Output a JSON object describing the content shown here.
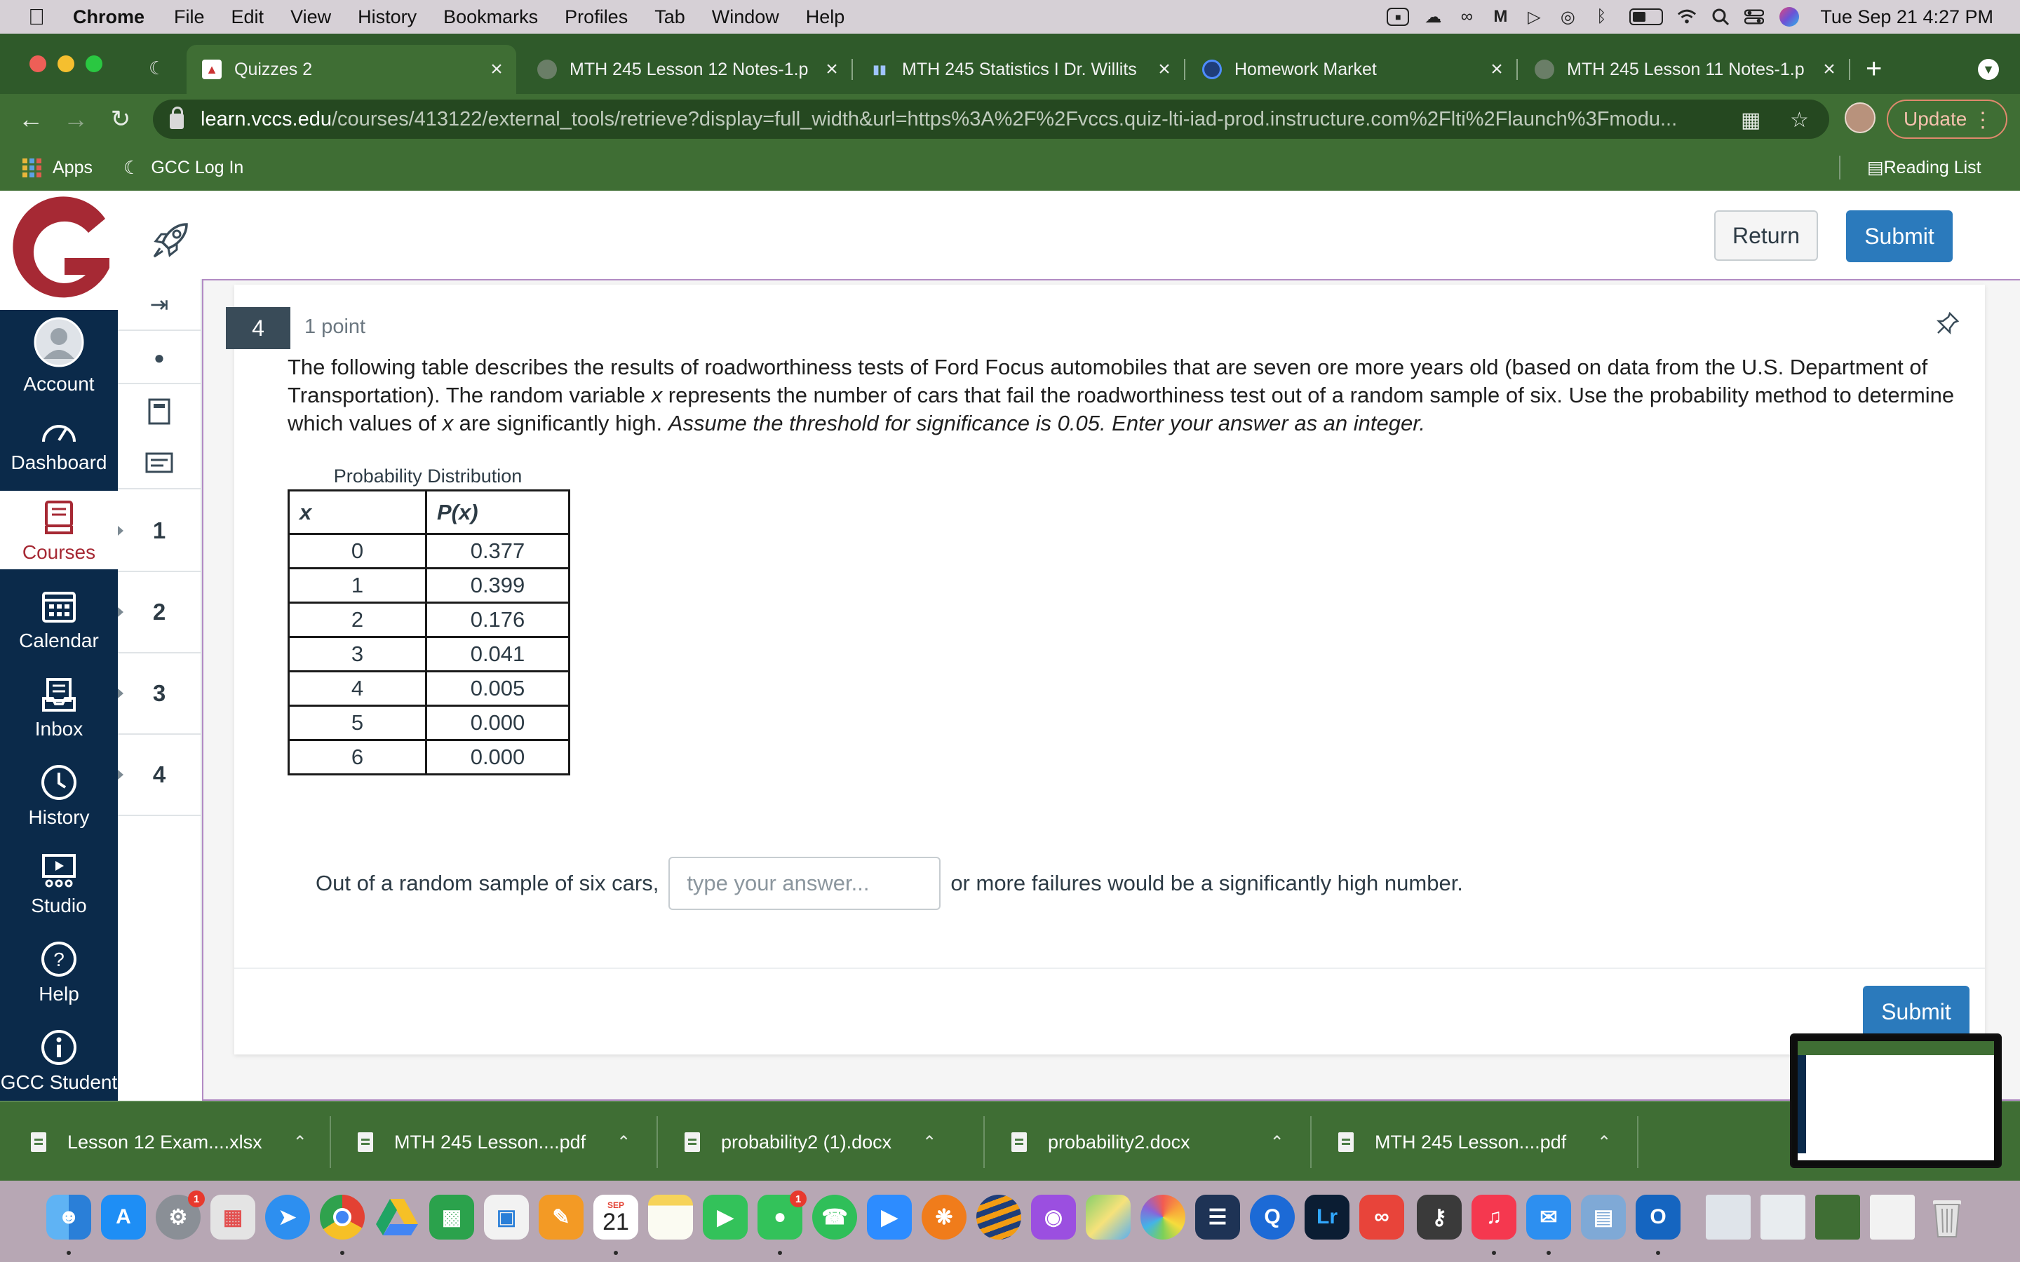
{
  "menubar": {
    "items": [
      "Chrome",
      "File",
      "Edit",
      "View",
      "History",
      "Bookmarks",
      "Profiles",
      "Tab",
      "Window",
      "Help"
    ],
    "clock": "Tue Sep 21  4:27 PM",
    "tray_icons": [
      "video-icon",
      "cloud-upload-icon",
      "creative-cloud-icon",
      "malwarebytes-icon",
      "play-icon",
      "airdrop-icon",
      "bluetooth-icon",
      "battery-icon",
      "wifi-icon",
      "spotlight-icon",
      "control-center-icon",
      "siri-icon"
    ]
  },
  "tabs": [
    {
      "title": "Quizzes 2",
      "active": true
    },
    {
      "title": "MTH 245 Lesson 12 Notes-1.p",
      "active": false
    },
    {
      "title": "MTH 245 Statistics I Dr. Willits",
      "active": false
    },
    {
      "title": "Homework Market",
      "active": false
    },
    {
      "title": "MTH 245 Lesson 11 Notes-1.p",
      "active": false
    }
  ],
  "toolbar": {
    "url_host": "learn.vccs.edu",
    "url_path": "/courses/413122/external_tools/retrieve?display=full_width&url=https%3A%2F%2Fvccs.quiz-lti-iad-prod.instructure.com%2Flti%2Flaunch%3Fmodu...",
    "update_label": "Update"
  },
  "bookmarks": {
    "apps": "Apps",
    "gcc_login": "GCC Log In",
    "reading_list": "Reading List"
  },
  "global_nav": [
    {
      "label": "Account",
      "icon": "account-icon"
    },
    {
      "label": "Dashboard",
      "icon": "dashboard-icon"
    },
    {
      "label": "Courses",
      "icon": "courses-icon",
      "active": true
    },
    {
      "label": "Calendar",
      "icon": "calendar-icon"
    },
    {
      "label": "Inbox",
      "icon": "inbox-icon"
    },
    {
      "label": "History",
      "icon": "history-icon"
    },
    {
      "label": "Studio",
      "icon": "studio-icon"
    },
    {
      "label": "Help",
      "icon": "help-icon"
    },
    {
      "label": "GCC Student",
      "icon": "info-icon"
    }
  ],
  "header": {
    "return_label": "Return",
    "submit_label": "Submit"
  },
  "question_nav": [
    "1",
    "2",
    "3",
    "4"
  ],
  "question": {
    "number": "4",
    "points": "1 point",
    "text": "The following table describes the results of roadworthiness tests of Ford Focus automobiles that are seven ore more years old (based on data from the U.S. Department of Transportation). The random variable ",
    "var": "x",
    "text2": " represents the number of cars that fail the roadworthiness test out of a random sample of six. Use the probability method to determine which values of ",
    "text3": " are significantly high. ",
    "instruction": "Assume the threshold for significance is 0.05. Enter your answer as an integer.",
    "table_caption": "Probability Distribution",
    "table_headers": [
      "x",
      "P(x)"
    ],
    "table_rows": [
      [
        "0",
        "0.377"
      ],
      [
        "1",
        "0.399"
      ],
      [
        "2",
        "0.176"
      ],
      [
        "3",
        "0.041"
      ],
      [
        "4",
        "0.005"
      ],
      [
        "5",
        "0.000"
      ],
      [
        "6",
        "0.000"
      ]
    ],
    "answer_prefix": "Out of a random sample of six cars,",
    "answer_placeholder": "type your answer...",
    "answer_value": "",
    "answer_suffix": "or more failures would be a significantly high number.",
    "submit_label": "Submit"
  },
  "downloads": [
    "Lesson 12 Exam....xlsx",
    "MTH 245 Lesson....pdf",
    "probability2 (1).docx",
    "probability2.docx",
    "MTH 245 Lesson....pdf"
  ],
  "dock": {
    "calendar_month": "SEP",
    "calendar_day": "21",
    "system_prefs_badge": "1",
    "messages_badge": "1",
    "lightroom_label": "Lr",
    "outlook_label": "O"
  }
}
